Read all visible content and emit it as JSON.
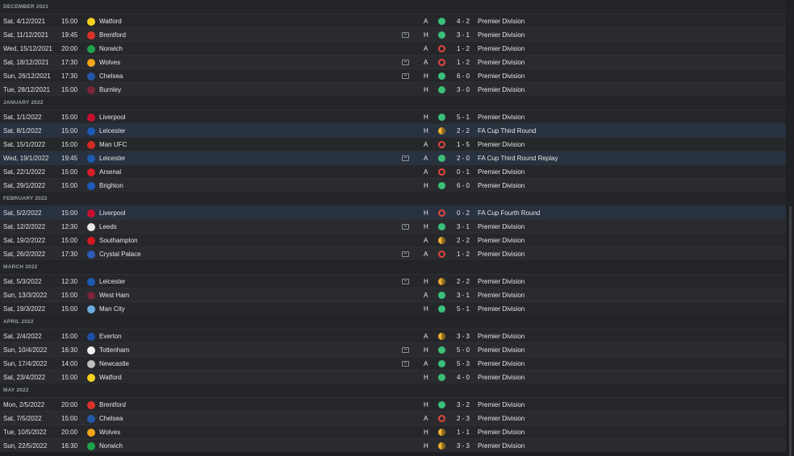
{
  "colors": {
    "win": "#3bc07a",
    "loss": "#e0473f",
    "draw": "#f0b030",
    "highlight_row": "#283240"
  },
  "groups": [
    {
      "month": "DECEMBER 2021",
      "matches": [
        {
          "date": "Sat, 4/12/2021",
          "time": "15:00",
          "opponent": "Watford",
          "badge": "watford-badge-icon",
          "badge_color": "#f5d21b",
          "tv": false,
          "venue": "A",
          "result": "W",
          "score": "4 - 2",
          "competition": "Premier Division"
        },
        {
          "date": "Sat, 11/12/2021",
          "time": "19:45",
          "opponent": "Brentford",
          "badge": "brentford-badge-icon",
          "badge_color": "#d8322b",
          "tv": true,
          "venue": "H",
          "result": "W",
          "score": "3 - 1",
          "competition": "Premier Division"
        },
        {
          "date": "Wed, 15/12/2021",
          "time": "20:00",
          "opponent": "Norwich",
          "badge": "norwich-badge-icon",
          "badge_color": "#20a34a",
          "tv": false,
          "venue": "A",
          "result": "L",
          "score": "1 - 2",
          "competition": "Premier Division"
        },
        {
          "date": "Sat, 18/12/2021",
          "time": "17:30",
          "opponent": "Wolves",
          "badge": "wolves-badge-icon",
          "badge_color": "#f3a617",
          "tv": true,
          "venue": "A",
          "result": "L",
          "score": "1 - 2",
          "competition": "Premier Division"
        },
        {
          "date": "Sun, 26/12/2021",
          "time": "17:30",
          "opponent": "Chelsea",
          "badge": "chelsea-badge-icon",
          "badge_color": "#2356a8",
          "tv": true,
          "venue": "H",
          "result": "W",
          "score": "6 - 0",
          "competition": "Premier Division"
        },
        {
          "date": "Tue, 28/12/2021",
          "time": "15:00",
          "opponent": "Burnley",
          "badge": "burnley-badge-icon",
          "badge_color": "#7a2638",
          "tv": false,
          "venue": "H",
          "result": "W",
          "score": "3 - 0",
          "competition": "Premier Division"
        }
      ]
    },
    {
      "month": "JANUARY 2022",
      "matches": [
        {
          "date": "Sat, 1/1/2022",
          "time": "15:00",
          "opponent": "Liverpool",
          "badge": "liverpool-badge-icon",
          "badge_color": "#c8102e",
          "tv": false,
          "venue": "H",
          "result": "W",
          "score": "5 - 1",
          "competition": "Premier Division"
        },
        {
          "date": "Sat, 8/1/2022",
          "time": "15:00",
          "opponent": "Leicester",
          "badge": "leicester-badge-icon",
          "badge_color": "#1d5ab4",
          "tv": false,
          "venue": "H",
          "result": "D",
          "score": "2 - 2",
          "competition": "FA Cup Third Round",
          "highlight": true
        },
        {
          "date": "Sat, 15/1/2022",
          "time": "15:00",
          "opponent": "Man UFC",
          "badge": "man-utd-badge-icon",
          "badge_color": "#d12a22",
          "tv": false,
          "venue": "A",
          "result": "L",
          "score": "1 - 5",
          "competition": "Premier Division"
        },
        {
          "date": "Wed, 19/1/2022",
          "time": "19:45",
          "opponent": "Leicester",
          "badge": "leicester-badge-icon",
          "badge_color": "#1d5ab4",
          "tv": true,
          "venue": "A",
          "result": "W",
          "score": "2 - 0",
          "competition": "FA Cup Third Round Replay",
          "highlight": true
        },
        {
          "date": "Sat, 22/1/2022",
          "time": "15:00",
          "opponent": "Arsenal",
          "badge": "arsenal-badge-icon",
          "badge_color": "#d3202a",
          "tv": false,
          "venue": "A",
          "result": "L",
          "score": "0 - 1",
          "competition": "Premier Division"
        },
        {
          "date": "Sat, 29/1/2022",
          "time": "15:00",
          "opponent": "Brighton",
          "badge": "brighton-badge-icon",
          "badge_color": "#1e58b8",
          "tv": false,
          "venue": "H",
          "result": "W",
          "score": "6 - 0",
          "competition": "Premier Division"
        }
      ]
    },
    {
      "month": "FEBRUARY 2022",
      "matches": [
        {
          "date": "Sat, 5/2/2022",
          "time": "15:00",
          "opponent": "Liverpool",
          "badge": "liverpool-badge-icon",
          "badge_color": "#c8102e",
          "tv": false,
          "venue": "H",
          "result": "L",
          "score": "0 - 2",
          "competition": "FA Cup Fourth Round",
          "highlight": true
        },
        {
          "date": "Sat, 12/2/2022",
          "time": "12:30",
          "opponent": "Leeds",
          "badge": "leeds-badge-icon",
          "badge_color": "#e8e8e8",
          "tv": true,
          "venue": "H",
          "result": "W",
          "score": "3 - 1",
          "competition": "Premier Division"
        },
        {
          "date": "Sat, 19/2/2022",
          "time": "15:00",
          "opponent": "Southampton",
          "badge": "southampton-badge-icon",
          "badge_color": "#d71920",
          "tv": false,
          "venue": "A",
          "result": "D",
          "score": "2 - 2",
          "competition": "Premier Division"
        },
        {
          "date": "Sat, 26/2/2022",
          "time": "17:30",
          "opponent": "Crystal Palace",
          "badge": "crystal-palace-badge-icon",
          "badge_color": "#2d5bb8",
          "tv": true,
          "venue": "A",
          "result": "L",
          "score": "1 - 2",
          "competition": "Premier Division"
        }
      ]
    },
    {
      "month": "MARCH 2022",
      "matches": [
        {
          "date": "Sat, 5/3/2022",
          "time": "12:30",
          "opponent": "Leicester",
          "badge": "leicester-badge-icon",
          "badge_color": "#1d5ab4",
          "tv": true,
          "venue": "H",
          "result": "D",
          "score": "2 - 2",
          "competition": "Premier Division"
        },
        {
          "date": "Sun, 13/3/2022",
          "time": "15:00",
          "opponent": "West Ham",
          "badge": "west-ham-badge-icon",
          "badge_color": "#7a2638",
          "tv": false,
          "venue": "A",
          "result": "W",
          "score": "3 - 1",
          "competition": "Premier Division"
        },
        {
          "date": "Sat, 19/3/2022",
          "time": "15:00",
          "opponent": "Man City",
          "badge": "man-city-badge-icon",
          "badge_color": "#6cabdd",
          "tv": false,
          "venue": "H",
          "result": "W",
          "score": "5 - 1",
          "competition": "Premier Division"
        }
      ]
    },
    {
      "month": "APRIL 2022",
      "matches": [
        {
          "date": "Sat, 2/4/2022",
          "time": "15:00",
          "opponent": "Everton",
          "badge": "everton-badge-icon",
          "badge_color": "#1e4fa8",
          "tv": false,
          "venue": "A",
          "result": "D",
          "score": "3 - 3",
          "competition": "Premier Division"
        },
        {
          "date": "Sun, 10/4/2022",
          "time": "16:30",
          "opponent": "Tottenham",
          "badge": "tottenham-badge-icon",
          "badge_color": "#f2f2f2",
          "tv": true,
          "venue": "H",
          "result": "W",
          "score": "5 - 0",
          "competition": "Premier Division"
        },
        {
          "date": "Sun, 17/4/2022",
          "time": "14:00",
          "opponent": "Newcastle",
          "badge": "newcastle-badge-icon",
          "badge_color": "#bfbfbf",
          "tv": true,
          "venue": "A",
          "result": "W",
          "score": "5 - 3",
          "competition": "Premier Division"
        },
        {
          "date": "Sat, 23/4/2022",
          "time": "15:00",
          "opponent": "Watford",
          "badge": "watford-badge-icon",
          "badge_color": "#f5d21b",
          "tv": false,
          "venue": "H",
          "result": "W",
          "score": "4 - 0",
          "competition": "Premier Division"
        }
      ]
    },
    {
      "month": "MAY 2022",
      "matches": [
        {
          "date": "Mon, 2/5/2022",
          "time": "20:00",
          "opponent": "Brentford",
          "badge": "brentford-badge-icon",
          "badge_color": "#d8322b",
          "tv": false,
          "venue": "H",
          "result": "W",
          "score": "3 - 2",
          "competition": "Premier Division"
        },
        {
          "date": "Sat, 7/5/2022",
          "time": "15:00",
          "opponent": "Chelsea",
          "badge": "chelsea-badge-icon",
          "badge_color": "#2356a8",
          "tv": false,
          "venue": "A",
          "result": "L",
          "score": "2 - 3",
          "competition": "Premier Division"
        },
        {
          "date": "Tue, 10/5/2022",
          "time": "20:00",
          "opponent": "Wolves",
          "badge": "wolves-badge-icon",
          "badge_color": "#f3a617",
          "tv": false,
          "venue": "H",
          "result": "D",
          "score": "1 - 1",
          "competition": "Premier Division"
        },
        {
          "date": "Sun, 22/5/2022",
          "time": "16:30",
          "opponent": "Norwich",
          "badge": "norwich-badge-icon",
          "badge_color": "#20a34a",
          "tv": false,
          "venue": "H",
          "result": "D",
          "score": "3 - 3",
          "competition": "Premier Division"
        }
      ]
    }
  ]
}
